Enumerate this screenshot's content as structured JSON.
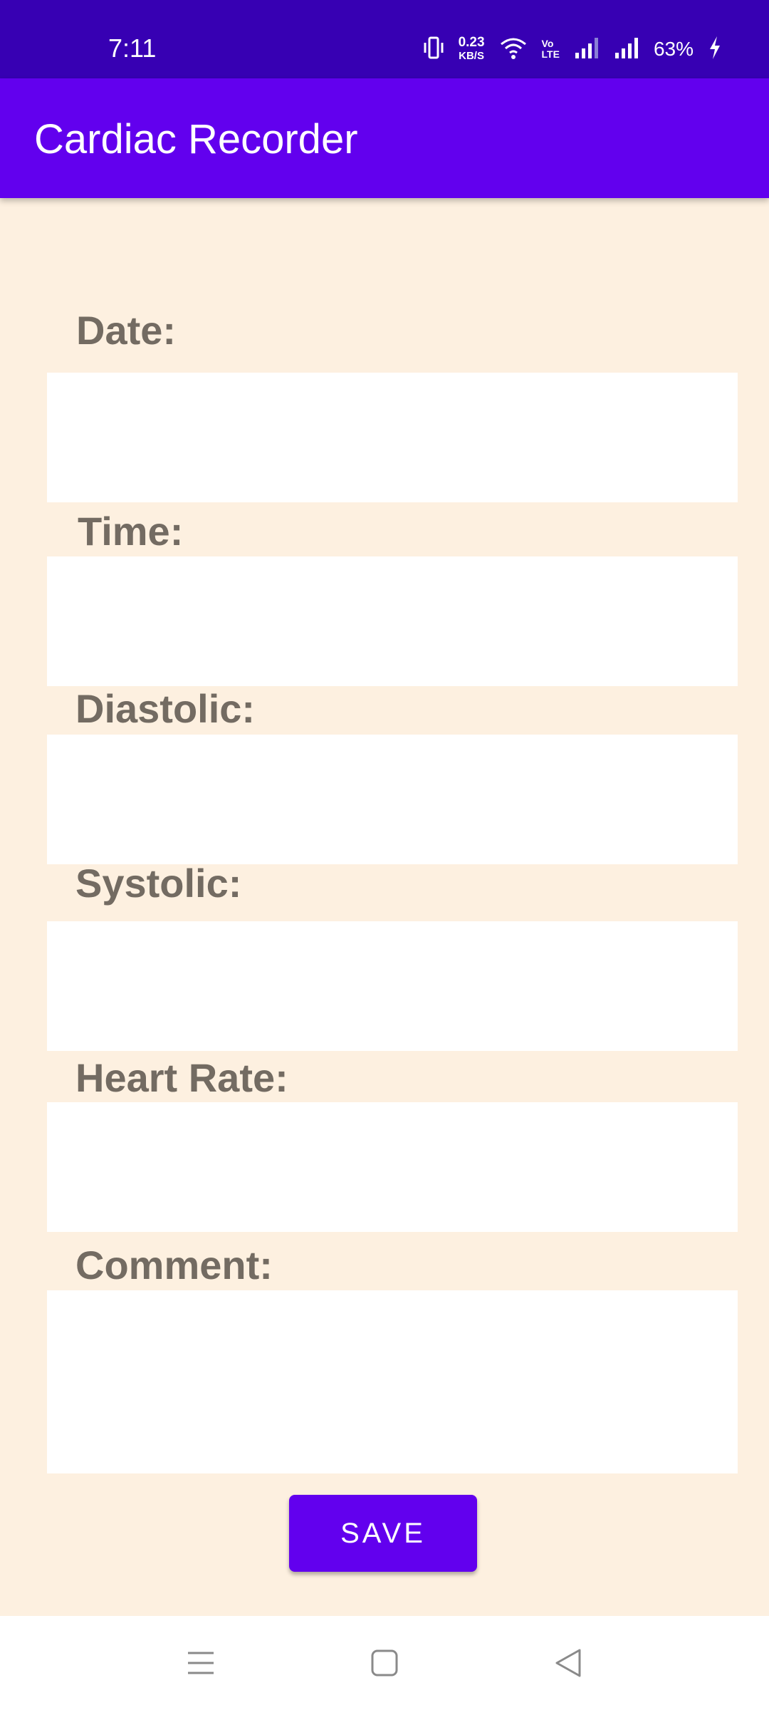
{
  "status_bar": {
    "time": "7:11",
    "net_speed_value": "0.23",
    "net_speed_unit": "KB/S",
    "volte_top": "Vo",
    "volte_bottom": "LTE",
    "battery": "63%",
    "icons": [
      "vibrate-icon",
      "wifi-icon",
      "signal-icon",
      "signal-icon",
      "charging-icon"
    ]
  },
  "app_bar": {
    "title": "Cardiac Recorder"
  },
  "form": {
    "date_label": "Date:",
    "time_label": "Time:",
    "diastolic_label": "Diastolic:",
    "systolic_label": "Systolic:",
    "heart_rate_label": "Heart Rate:",
    "comment_label": "Comment:",
    "date_value": "",
    "time_value": "",
    "diastolic_value": "",
    "systolic_value": "",
    "heart_rate_value": "",
    "comment_value": "",
    "save_label": "SAVE"
  },
  "nav_bar": {
    "icons": [
      "menu-icon",
      "home-icon",
      "back-icon"
    ]
  },
  "colors": {
    "status_bar": "#3700B3",
    "primary": "#6200EE",
    "background": "#FDF0E0",
    "label_text": "#736B62"
  }
}
